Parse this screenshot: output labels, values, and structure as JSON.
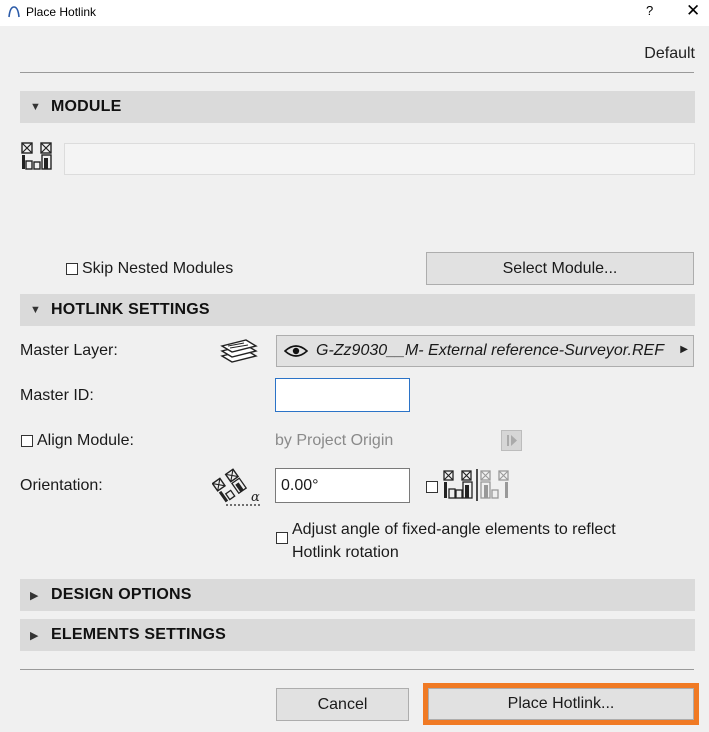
{
  "window": {
    "title": "Place Hotlink",
    "help_label": "?",
    "close_label": "✕"
  },
  "preset": "Default",
  "sections": {
    "module": "MODULE",
    "hotlink_settings": "HOTLINK SETTINGS",
    "design_options": "DESIGN OPTIONS",
    "elements_settings": "ELEMENTS SETTINGS"
  },
  "module": {
    "path_value": "",
    "skip_nested_label": "Skip Nested Modules",
    "skip_nested_checked": false,
    "select_module_label": "Select Module..."
  },
  "hotlink": {
    "master_layer_label": "Master Layer:",
    "master_layer_value": "G-Zz9030__M- External reference-Surveyor.REF",
    "master_id_label": "Master ID:",
    "master_id_value": "",
    "align_module_label": "Align Module:",
    "align_module_checked": false,
    "align_value": "by Project Origin",
    "orientation_label": "Orientation:",
    "orientation_value": "0.00°",
    "adjust_angle_line1": "Adjust angle of fixed-angle elements to reflect",
    "adjust_angle_line2": "Hotlink rotation",
    "adjust_angle_checked": false
  },
  "footer": {
    "cancel_label": "Cancel",
    "place_label": "Place Hotlink..."
  },
  "colors": {
    "highlight": "#f07a24",
    "section_bg": "#dadada",
    "window_bg": "#f0f0f0"
  }
}
